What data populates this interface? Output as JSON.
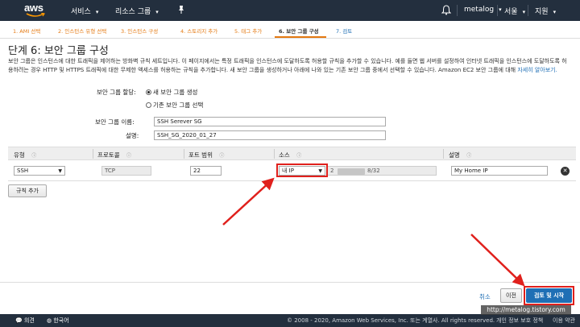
{
  "colors": {
    "nav_bg": "#232f3e",
    "accent_orange": "#e47911",
    "link_blue": "#1f6fb5",
    "annotation_red": "#e0201c"
  },
  "topnav": {
    "logo": "aws",
    "services": "서비스",
    "resource_groups": "리소스 그룹",
    "user": "metalog",
    "region": "서울",
    "support": "지원"
  },
  "wizard": {
    "tabs": [
      {
        "label": "1. AMI 선택"
      },
      {
        "label": "2. 인스턴스 유형 선택"
      },
      {
        "label": "3. 인스턴스 구성"
      },
      {
        "label": "4. 스토리지 추가"
      },
      {
        "label": "5. 태그 추가"
      },
      {
        "label": "6. 보안 그룹 구성"
      },
      {
        "label": "7. 검토"
      }
    ]
  },
  "page": {
    "title": "단계 6: 보안 그룹 구성",
    "description": "보안 그룹은 인스턴스에 대한 트래픽을 제어하는 방화벽 규칙 세트입니다. 이 페이지에서는 특정 트래픽을 인스턴스에 도달하도록 허용할 규칙을 추가할 수 있습니다. 예를 들면 웹 서버를 설정하여 인터넷 트래픽을 인스턴스에 도달하도록 허용하려는 경우 HTTP 및 HTTPS 트래픽에 대한 무제한 액세스를 허용하는 규칙을 추가합니다. 새 보안 그룹을 생성하거나 아래에 나와 있는 기존 보안 그룹 중에서 선택할 수 있습니다. Amazon EC2 보안 그룹에 대해 ",
    "learn_more": "자세히 알아보기."
  },
  "form": {
    "assign_label": "보안 그룹 할당:",
    "option_new": "새 보안 그룹 생성",
    "option_existing": "기존 보안 그룹 선택",
    "name_label": "보안 그룹 이름:",
    "name_value": "SSH Serever SG",
    "desc_label": "설명:",
    "desc_value": "SSH_SG_2020_01_27"
  },
  "table": {
    "headers": {
      "type": "유형",
      "protocol": "프로토콜",
      "port_range": "포트 범위",
      "source": "소스",
      "description": "설명"
    },
    "header_info_icon": "ⓘ",
    "rows": [
      {
        "type": "SSH",
        "protocol": "TCP",
        "port": "22",
        "source_select": "내 IP",
        "source_prefix": "2",
        "source_suffix": "8/32",
        "description": "My Home IP"
      }
    ],
    "add_rule": "규칙 추가"
  },
  "actions": {
    "cancel": "취소",
    "previous": "이전",
    "review_launch": "검토 및 시작"
  },
  "bottombar": {
    "feedback": "의견",
    "language": "한국어",
    "copyright": "© 2008 - 2020, Amazon Web Services, Inc. 또는 계열사. All rights reserved.",
    "privacy": "개인 정보 보호 정책",
    "terms": "이용 약관"
  },
  "watermark": "http://metalog.tistory.com"
}
